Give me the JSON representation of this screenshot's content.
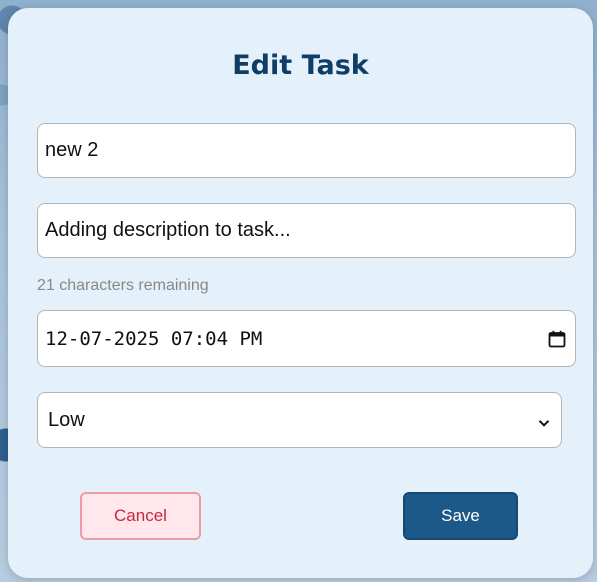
{
  "modal": {
    "title": "Edit Task"
  },
  "form": {
    "task_name": {
      "value": "new 2"
    },
    "description": {
      "value": "Adding description to task..."
    },
    "counter_text": "21 characters remaining",
    "due_datetime": {
      "value": "12-07-2025 07:04 PM",
      "icon": "calendar-icon"
    },
    "priority": {
      "selected": "Low",
      "icon": "chevron-down-icon"
    }
  },
  "buttons": {
    "cancel_label": "Cancel",
    "save_label": "Save"
  },
  "colors": {
    "title": "#0f3d66",
    "modal_bg": "#e4f1fa",
    "save_bg": "#1c5888",
    "cancel_text": "#c8283f",
    "cancel_bg": "#ffe7ec",
    "cancel_border": "#ef9aa7"
  }
}
